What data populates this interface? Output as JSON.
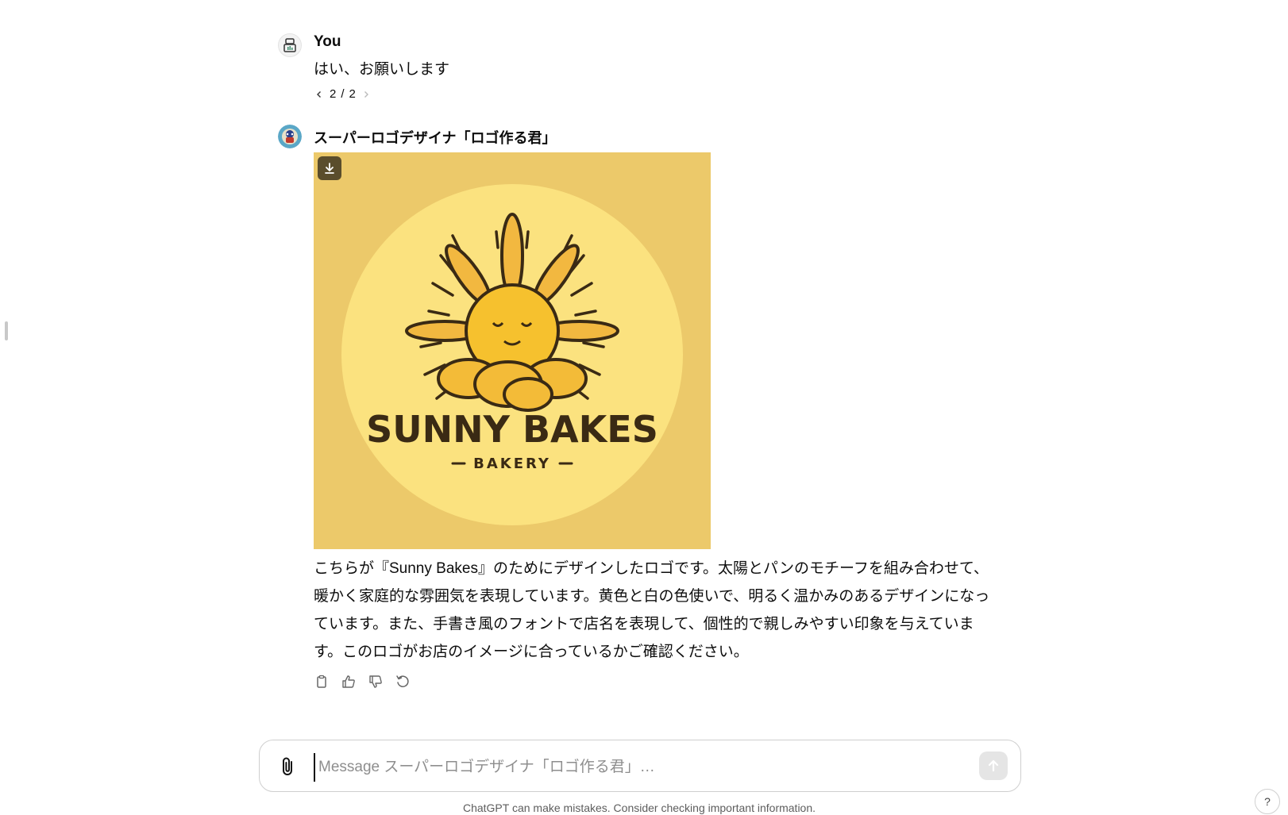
{
  "user_message": {
    "author": "You",
    "text": "はい、お願いします",
    "pager": {
      "current": "2",
      "separator": "/",
      "total": "2"
    }
  },
  "bot_message": {
    "author": "スーパーロゴデザイナ「ロゴ作る君」",
    "image": {
      "logo_title": "SUNNY BAKES",
      "logo_subtitle": "BAKERY",
      "colors": {
        "background": "#ecc96a",
        "circle": "#fbe27f",
        "sun": "#f6c12e",
        "ink": "#3a2a14"
      }
    },
    "text": "こちらが『Sunny Bakes』のためにデザインしたロゴです。太陽とパンのモチーフを組み合わせて、暖かく家庭的な雰囲気を表現しています。黄色と白の色使いで、明るく温かみのあるデザインになっています。また、手書き風のフォントで店名を表現して、個性的で親しみやすい印象を与えています。このロゴがお店のイメージに合っているかご確認ください。",
    "actions": [
      "copy-icon",
      "thumbs-up-icon",
      "thumbs-down-icon",
      "regenerate-icon"
    ]
  },
  "composer": {
    "placeholder": "Message スーパーロゴデザイナ「ロゴ作る君」…",
    "value": ""
  },
  "disclaimer": "ChatGPT can make mistakes. Consider checking important information.",
  "help_label": "?"
}
